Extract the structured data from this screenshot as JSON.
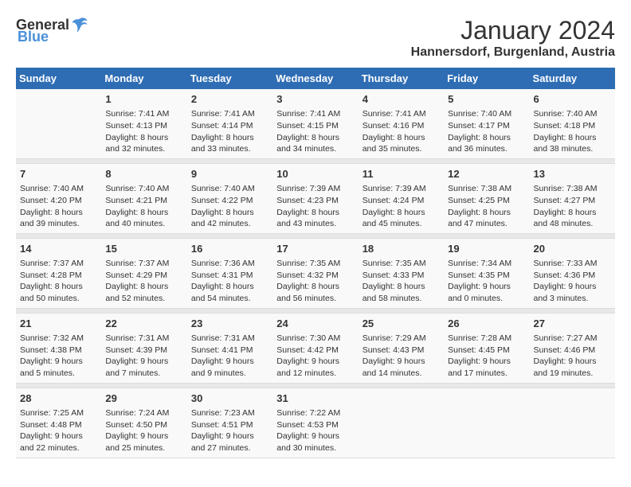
{
  "logo": {
    "general": "General",
    "blue": "Blue"
  },
  "header": {
    "title": "January 2024",
    "subtitle": "Hannersdorf, Burgenland, Austria"
  },
  "weekdays": [
    "Sunday",
    "Monday",
    "Tuesday",
    "Wednesday",
    "Thursday",
    "Friday",
    "Saturday"
  ],
  "weeks": [
    {
      "days": [
        {
          "date": "",
          "info": ""
        },
        {
          "date": "1",
          "info": "Sunrise: 7:41 AM\nSunset: 4:13 PM\nDaylight: 8 hours\nand 32 minutes."
        },
        {
          "date": "2",
          "info": "Sunrise: 7:41 AM\nSunset: 4:14 PM\nDaylight: 8 hours\nand 33 minutes."
        },
        {
          "date": "3",
          "info": "Sunrise: 7:41 AM\nSunset: 4:15 PM\nDaylight: 8 hours\nand 34 minutes."
        },
        {
          "date": "4",
          "info": "Sunrise: 7:41 AM\nSunset: 4:16 PM\nDaylight: 8 hours\nand 35 minutes."
        },
        {
          "date": "5",
          "info": "Sunrise: 7:40 AM\nSunset: 4:17 PM\nDaylight: 8 hours\nand 36 minutes."
        },
        {
          "date": "6",
          "info": "Sunrise: 7:40 AM\nSunset: 4:18 PM\nDaylight: 8 hours\nand 38 minutes."
        }
      ]
    },
    {
      "days": [
        {
          "date": "7",
          "info": "Sunrise: 7:40 AM\nSunset: 4:20 PM\nDaylight: 8 hours\nand 39 minutes."
        },
        {
          "date": "8",
          "info": "Sunrise: 7:40 AM\nSunset: 4:21 PM\nDaylight: 8 hours\nand 40 minutes."
        },
        {
          "date": "9",
          "info": "Sunrise: 7:40 AM\nSunset: 4:22 PM\nDaylight: 8 hours\nand 42 minutes."
        },
        {
          "date": "10",
          "info": "Sunrise: 7:39 AM\nSunset: 4:23 PM\nDaylight: 8 hours\nand 43 minutes."
        },
        {
          "date": "11",
          "info": "Sunrise: 7:39 AM\nSunset: 4:24 PM\nDaylight: 8 hours\nand 45 minutes."
        },
        {
          "date": "12",
          "info": "Sunrise: 7:38 AM\nSunset: 4:25 PM\nDaylight: 8 hours\nand 47 minutes."
        },
        {
          "date": "13",
          "info": "Sunrise: 7:38 AM\nSunset: 4:27 PM\nDaylight: 8 hours\nand 48 minutes."
        }
      ]
    },
    {
      "days": [
        {
          "date": "14",
          "info": "Sunrise: 7:37 AM\nSunset: 4:28 PM\nDaylight: 8 hours\nand 50 minutes."
        },
        {
          "date": "15",
          "info": "Sunrise: 7:37 AM\nSunset: 4:29 PM\nDaylight: 8 hours\nand 52 minutes."
        },
        {
          "date": "16",
          "info": "Sunrise: 7:36 AM\nSunset: 4:31 PM\nDaylight: 8 hours\nand 54 minutes."
        },
        {
          "date": "17",
          "info": "Sunrise: 7:35 AM\nSunset: 4:32 PM\nDaylight: 8 hours\nand 56 minutes."
        },
        {
          "date": "18",
          "info": "Sunrise: 7:35 AM\nSunset: 4:33 PM\nDaylight: 8 hours\nand 58 minutes."
        },
        {
          "date": "19",
          "info": "Sunrise: 7:34 AM\nSunset: 4:35 PM\nDaylight: 9 hours\nand 0 minutes."
        },
        {
          "date": "20",
          "info": "Sunrise: 7:33 AM\nSunset: 4:36 PM\nDaylight: 9 hours\nand 3 minutes."
        }
      ]
    },
    {
      "days": [
        {
          "date": "21",
          "info": "Sunrise: 7:32 AM\nSunset: 4:38 PM\nDaylight: 9 hours\nand 5 minutes."
        },
        {
          "date": "22",
          "info": "Sunrise: 7:31 AM\nSunset: 4:39 PM\nDaylight: 9 hours\nand 7 minutes."
        },
        {
          "date": "23",
          "info": "Sunrise: 7:31 AM\nSunset: 4:41 PM\nDaylight: 9 hours\nand 9 minutes."
        },
        {
          "date": "24",
          "info": "Sunrise: 7:30 AM\nSunset: 4:42 PM\nDaylight: 9 hours\nand 12 minutes."
        },
        {
          "date": "25",
          "info": "Sunrise: 7:29 AM\nSunset: 4:43 PM\nDaylight: 9 hours\nand 14 minutes."
        },
        {
          "date": "26",
          "info": "Sunrise: 7:28 AM\nSunset: 4:45 PM\nDaylight: 9 hours\nand 17 minutes."
        },
        {
          "date": "27",
          "info": "Sunrise: 7:27 AM\nSunset: 4:46 PM\nDaylight: 9 hours\nand 19 minutes."
        }
      ]
    },
    {
      "days": [
        {
          "date": "28",
          "info": "Sunrise: 7:25 AM\nSunset: 4:48 PM\nDaylight: 9 hours\nand 22 minutes."
        },
        {
          "date": "29",
          "info": "Sunrise: 7:24 AM\nSunset: 4:50 PM\nDaylight: 9 hours\nand 25 minutes."
        },
        {
          "date": "30",
          "info": "Sunrise: 7:23 AM\nSunset: 4:51 PM\nDaylight: 9 hours\nand 27 minutes."
        },
        {
          "date": "31",
          "info": "Sunrise: 7:22 AM\nSunset: 4:53 PM\nDaylight: 9 hours\nand 30 minutes."
        },
        {
          "date": "",
          "info": ""
        },
        {
          "date": "",
          "info": ""
        },
        {
          "date": "",
          "info": ""
        }
      ]
    }
  ]
}
